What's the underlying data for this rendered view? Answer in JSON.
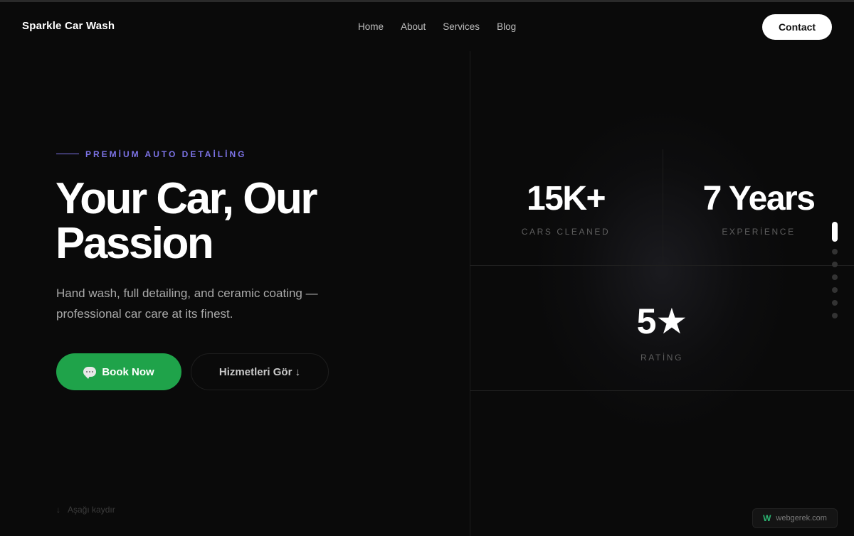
{
  "nav": {
    "brand": "Sparkle Car Wash",
    "links": [
      "Home",
      "About",
      "Services",
      "Blog"
    ],
    "contact_label": "Contact"
  },
  "hero": {
    "eyebrow": "PREMİUM AUTO DETAİLİNG",
    "title_line1": "Your Car, Our",
    "title_line2": "Passion",
    "subtitle": "Hand wash, full detailing, and ceramic coating — professional car care at its finest.",
    "primary_button": "Book Now",
    "secondary_button": "Hizmetleri Gör ↓",
    "scroll_hint": "Aşağı kaydır"
  },
  "stats": [
    {
      "value": "15K+",
      "label": "CARS CLEANED"
    },
    {
      "value": "7 Years",
      "label": "EXPERİENCE"
    },
    {
      "value": "5★",
      "label": "RATİNG"
    }
  ],
  "slider": {
    "total_dots": 7,
    "active_index": 0
  },
  "watermark": {
    "logo": "W",
    "text": "webgerek.com"
  },
  "colors": {
    "background": "#0a0a0a",
    "accent": "#7c73e6",
    "primary_button": "#1fa34a",
    "contact_button": "#ffffff"
  },
  "icons": {
    "book_button": "chat-bubble-icon",
    "scroll_hint": "arrow-down-icon"
  }
}
